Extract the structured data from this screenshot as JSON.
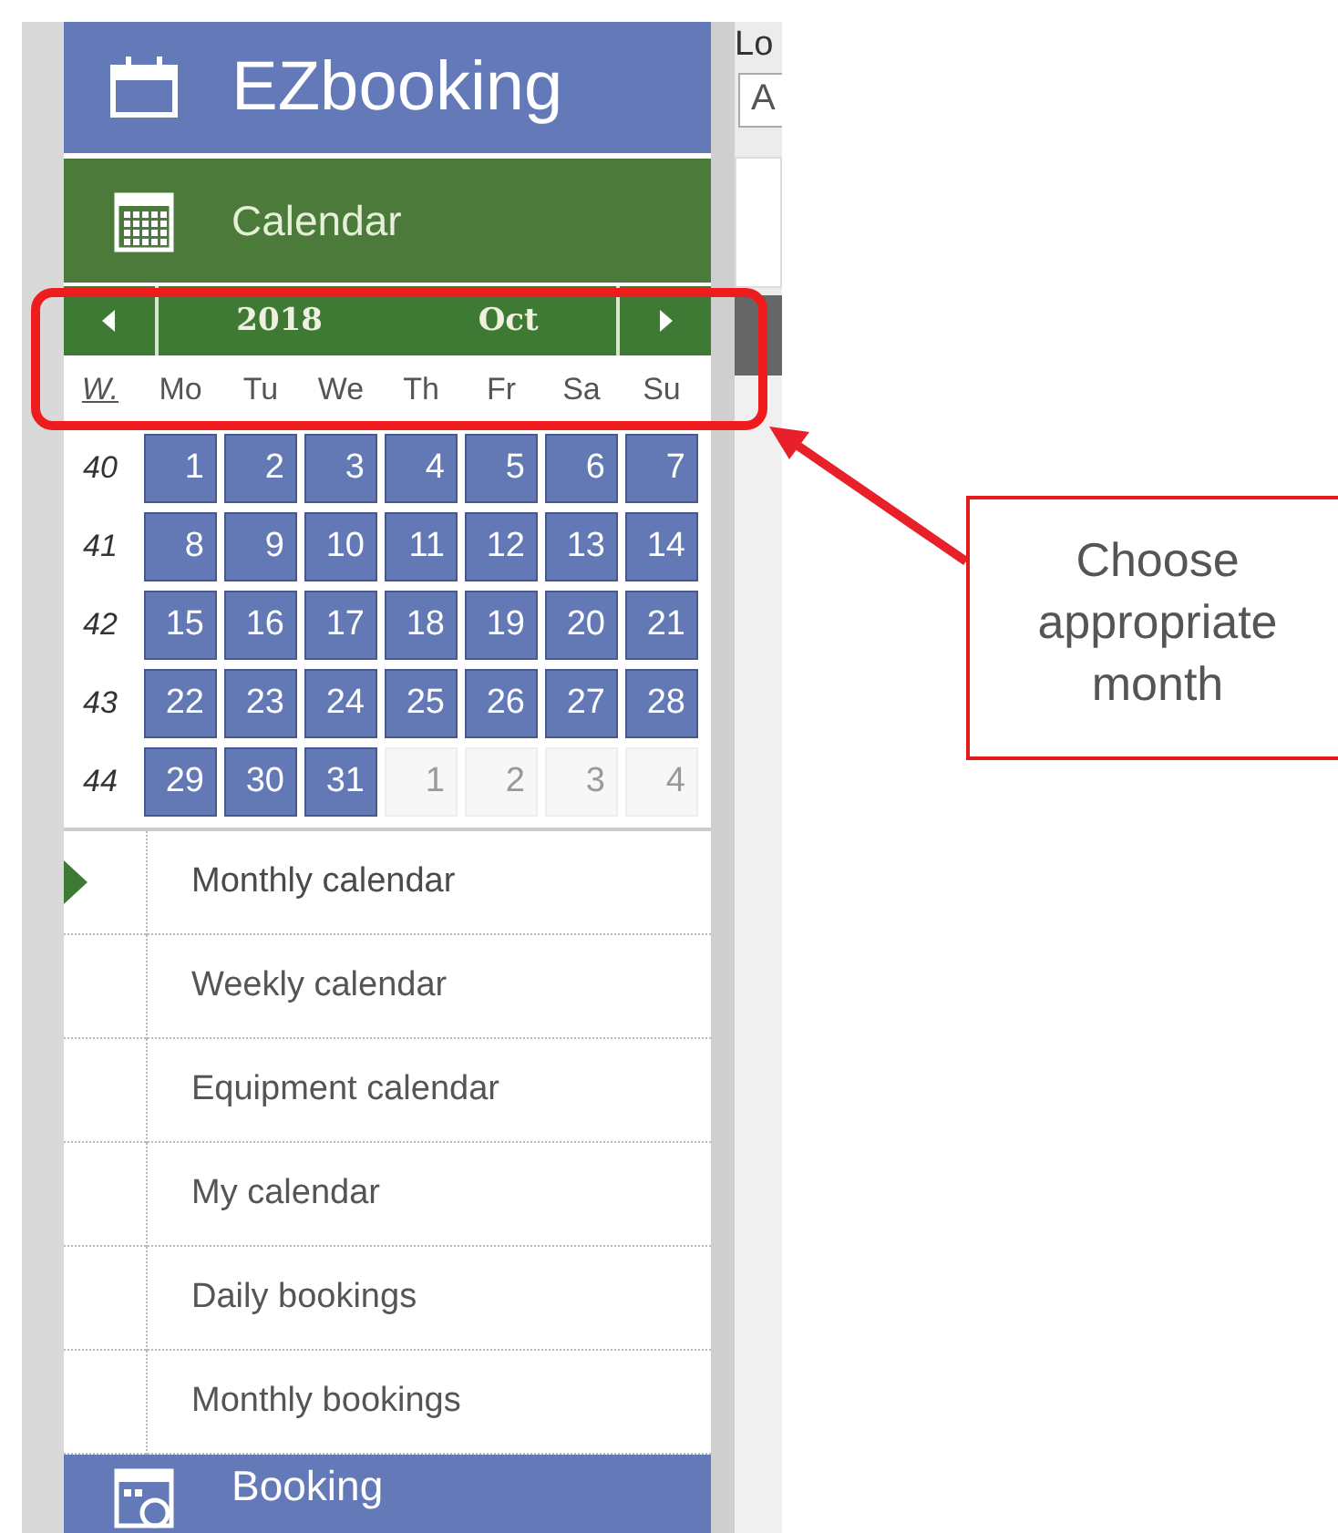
{
  "app": {
    "title": "EZbooking"
  },
  "calendar_section": {
    "label": "Calendar",
    "selected": true
  },
  "month_nav": {
    "year": "2018",
    "month": "Oct"
  },
  "weekday_headers": [
    "W.",
    "Mo",
    "Tu",
    "We",
    "Th",
    "Fr",
    "Sa",
    "Su"
  ],
  "weeks": [
    {
      "number": "40",
      "days": [
        {
          "label": "1",
          "in_month": true
        },
        {
          "label": "2",
          "in_month": true
        },
        {
          "label": "3",
          "in_month": true
        },
        {
          "label": "4",
          "in_month": true
        },
        {
          "label": "5",
          "in_month": true
        },
        {
          "label": "6",
          "in_month": true
        },
        {
          "label": "7",
          "in_month": true
        }
      ]
    },
    {
      "number": "41",
      "days": [
        {
          "label": "8",
          "in_month": true
        },
        {
          "label": "9",
          "in_month": true
        },
        {
          "label": "10",
          "in_month": true
        },
        {
          "label": "11",
          "in_month": true
        },
        {
          "label": "12",
          "in_month": true
        },
        {
          "label": "13",
          "in_month": true
        },
        {
          "label": "14",
          "in_month": true
        }
      ]
    },
    {
      "number": "42",
      "days": [
        {
          "label": "15",
          "in_month": true
        },
        {
          "label": "16",
          "in_month": true
        },
        {
          "label": "17",
          "in_month": true
        },
        {
          "label": "18",
          "in_month": true
        },
        {
          "label": "19",
          "in_month": true
        },
        {
          "label": "20",
          "in_month": true
        },
        {
          "label": "21",
          "in_month": true
        }
      ]
    },
    {
      "number": "43",
      "days": [
        {
          "label": "22",
          "in_month": true
        },
        {
          "label": "23",
          "in_month": true
        },
        {
          "label": "24",
          "in_month": true
        },
        {
          "label": "25",
          "in_month": true
        },
        {
          "label": "26",
          "in_month": true
        },
        {
          "label": "27",
          "in_month": true
        },
        {
          "label": "28",
          "in_month": true
        }
      ]
    },
    {
      "number": "44",
      "days": [
        {
          "label": "29",
          "in_month": true
        },
        {
          "label": "30",
          "in_month": true
        },
        {
          "label": "31",
          "in_month": true
        },
        {
          "label": "1",
          "in_month": false
        },
        {
          "label": "2",
          "in_month": false
        },
        {
          "label": "3",
          "in_month": false
        },
        {
          "label": "4",
          "in_month": false
        }
      ]
    }
  ],
  "menu_items": [
    {
      "label": "Monthly calendar",
      "selected": true
    },
    {
      "label": "Weekly calendar",
      "selected": false
    },
    {
      "label": "Equipment calendar",
      "selected": false
    },
    {
      "label": "My calendar",
      "selected": false
    },
    {
      "label": "Daily bookings",
      "selected": false
    },
    {
      "label": "Monthly bookings",
      "selected": false
    }
  ],
  "booking_section": {
    "label": "Booking",
    "selected": false
  },
  "side_panel": {
    "label": "Lo",
    "field_value": "A"
  },
  "callout": {
    "text": "Choose appropriate month"
  }
}
